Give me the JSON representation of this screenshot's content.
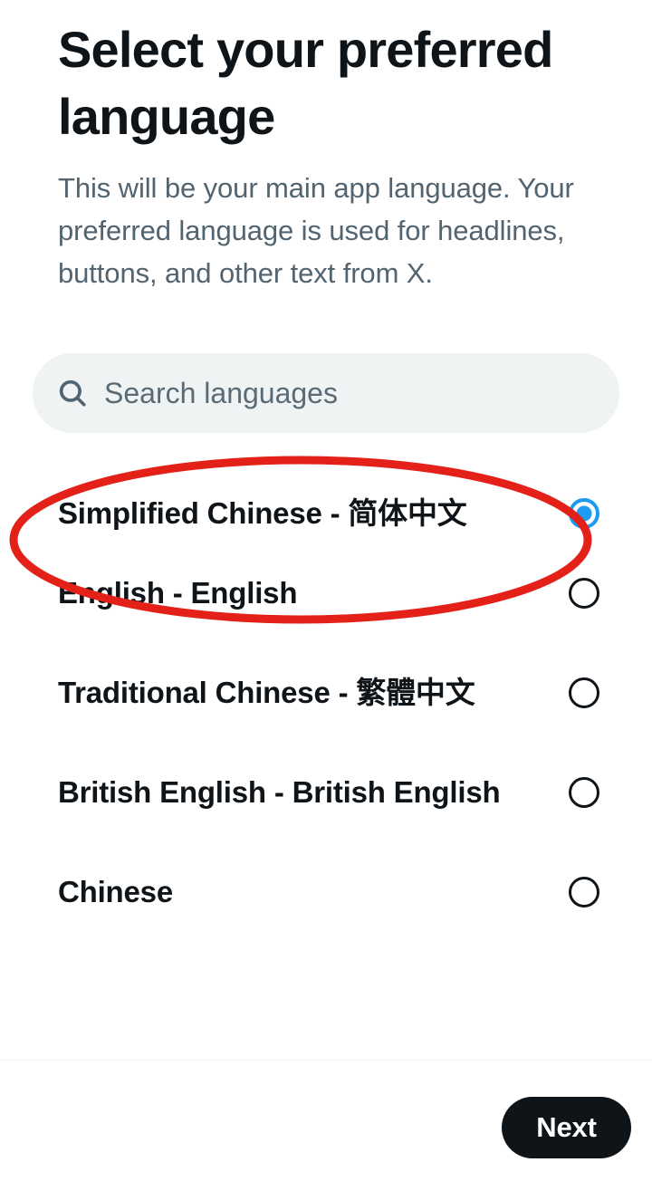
{
  "header": {
    "title": "Select your preferred language",
    "subtitle": "This will be your main app language. Your preferred language is used for headlines, buttons, and other text from X."
  },
  "search": {
    "icon": "search-icon",
    "placeholder": "Search languages",
    "value": ""
  },
  "language_list": {
    "items": [
      {
        "label": "Simplified Chinese - 简体中文",
        "selected": true
      },
      {
        "label": "English - English",
        "selected": false
      },
      {
        "label": "Traditional Chinese - 繁體中文",
        "selected": false
      },
      {
        "label": "British English - British English",
        "selected": false
      },
      {
        "label": "Chinese",
        "selected": false
      }
    ]
  },
  "annotation": {
    "type": "ellipse",
    "color": "#e32119",
    "stroke_width": 9,
    "targets": "Simplified Chinese - 简体中文"
  },
  "bottom_bar": {
    "next_label": "Next"
  },
  "colors": {
    "text_primary": "#0f1419",
    "text_secondary": "#536471",
    "accent_blue": "#1d9bf0",
    "search_background": "#eff3f4",
    "button_background": "#0f1419",
    "annotation_red": "#e32119",
    "divider": "#eff3f4"
  }
}
